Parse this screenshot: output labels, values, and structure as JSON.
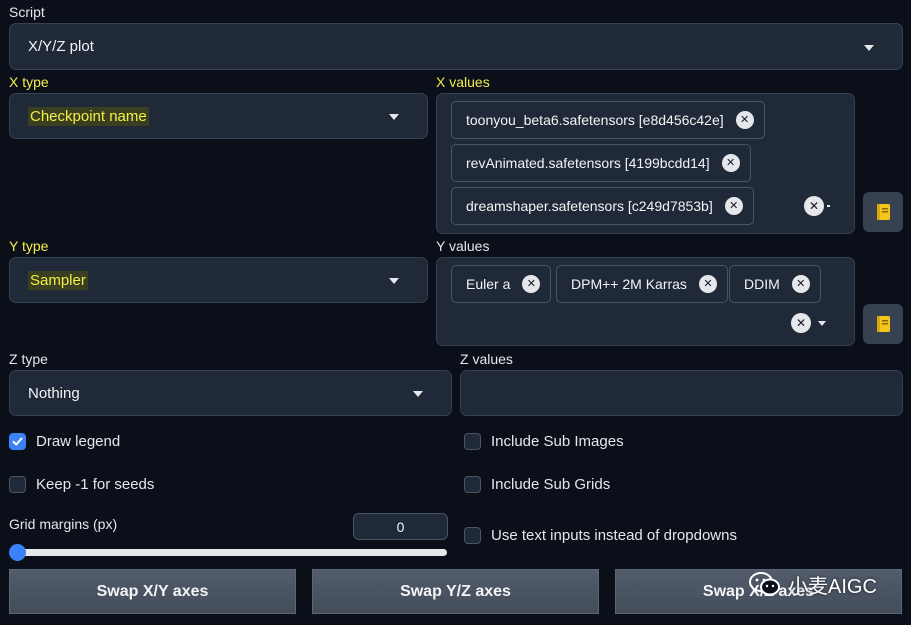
{
  "script": {
    "label": "Script",
    "value": "X/Y/Z plot"
  },
  "x_type": {
    "label": "X type",
    "value": "Checkpoint name"
  },
  "x_values": {
    "label": "X values",
    "tokens": [
      "toonyou_beta6.safetensors [e8d456c42e]",
      "revAnimated.safetensors [4199bcdd14]",
      "dreamshaper.safetensors [c249d7853b]"
    ]
  },
  "y_type": {
    "label": "Y type",
    "value": "Sampler"
  },
  "y_values": {
    "label": "Y values",
    "tokens": [
      "Euler a",
      "DPM++ 2M Karras",
      "DDIM"
    ]
  },
  "z_type": {
    "label": "Z type",
    "value": "Nothing"
  },
  "z_values": {
    "label": "Z values",
    "value": ""
  },
  "options": {
    "draw_legend": {
      "label": "Draw legend",
      "checked": true
    },
    "include_sub_images": {
      "label": "Include Sub Images",
      "checked": false
    },
    "keep_seeds": {
      "label": "Keep -1 for seeds",
      "checked": false
    },
    "include_sub_grids": {
      "label": "Include Sub Grids",
      "checked": false
    },
    "use_text_inputs": {
      "label": "Use text inputs instead of dropdowns",
      "checked": false
    }
  },
  "grid_margins": {
    "label": "Grid margins (px)",
    "value": "0",
    "slider_fraction": 0
  },
  "buttons": {
    "swap_xy": "Swap X/Y axes",
    "swap_yz": "Swap Y/Z axes",
    "swap_xz": "Swap X/Z axes"
  },
  "watermark": {
    "text": "小麦AIGC"
  },
  "colors": {
    "background": "#0b0f19",
    "panel": "#1f2937",
    "accent": "#3b82f6",
    "highlight": "#f4ee4a"
  }
}
